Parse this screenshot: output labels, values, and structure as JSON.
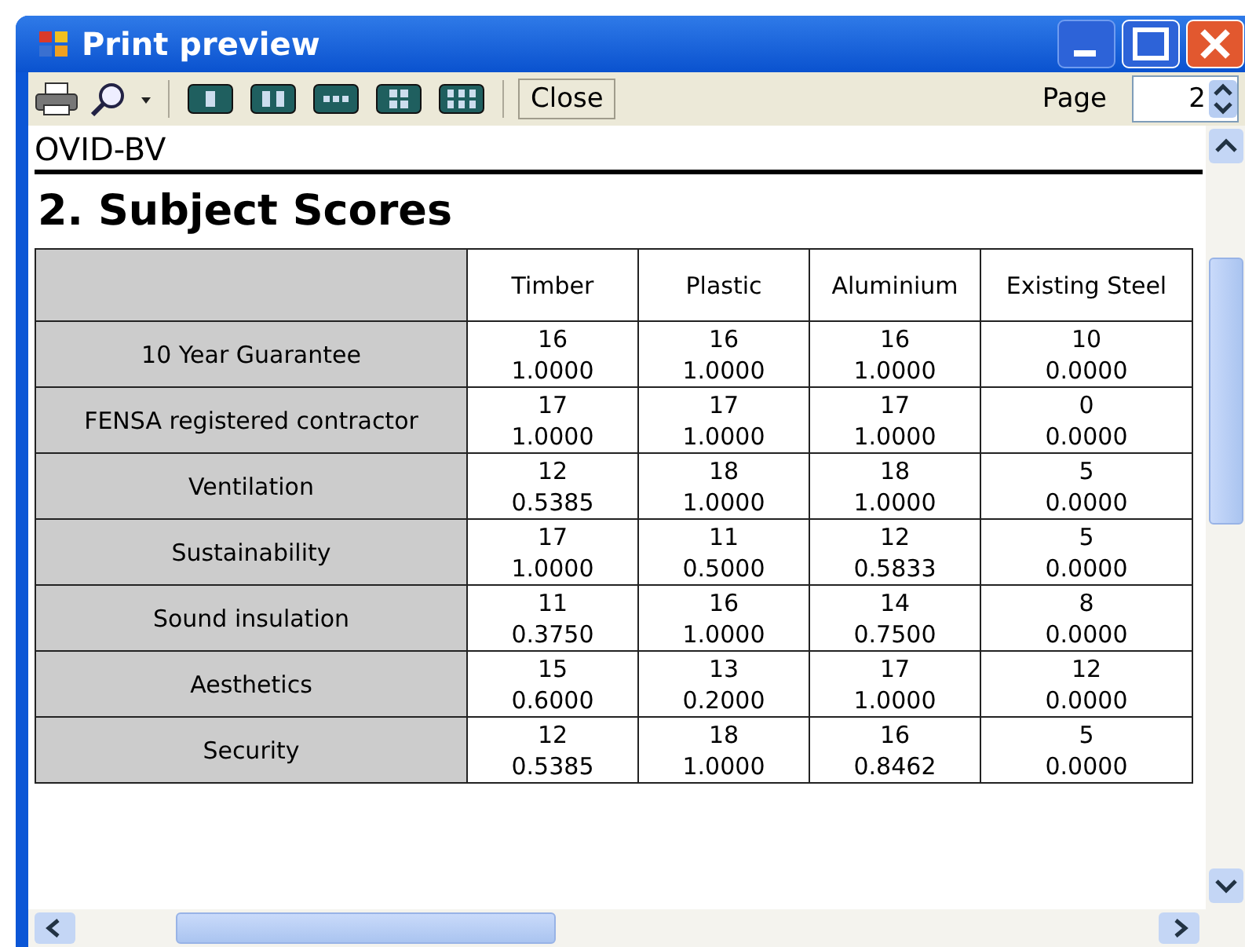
{
  "window": {
    "title": "Print preview"
  },
  "toolbar": {
    "close_button": "Close",
    "page_label": "Page",
    "page_value": "2"
  },
  "document": {
    "header": "OVID-BV",
    "heading": "2. Subject Scores",
    "table": {
      "columns": [
        "Timber",
        "Plastic",
        "Aluminium",
        "Existing Steel"
      ],
      "rows": [
        {
          "label": "10 Year Guarantee",
          "cells": [
            {
              "score": "16",
              "weight": "1.0000"
            },
            {
              "score": "16",
              "weight": "1.0000"
            },
            {
              "score": "16",
              "weight": "1.0000"
            },
            {
              "score": "10",
              "weight": "0.0000"
            }
          ]
        },
        {
          "label": "FENSA registered contractor",
          "cells": [
            {
              "score": "17",
              "weight": "1.0000"
            },
            {
              "score": "17",
              "weight": "1.0000"
            },
            {
              "score": "17",
              "weight": "1.0000"
            },
            {
              "score": "0",
              "weight": "0.0000"
            }
          ]
        },
        {
          "label": "Ventilation",
          "cells": [
            {
              "score": "12",
              "weight": "0.5385"
            },
            {
              "score": "18",
              "weight": "1.0000"
            },
            {
              "score": "18",
              "weight": "1.0000"
            },
            {
              "score": "5",
              "weight": "0.0000"
            }
          ]
        },
        {
          "label": "Sustainability",
          "cells": [
            {
              "score": "17",
              "weight": "1.0000"
            },
            {
              "score": "11",
              "weight": "0.5000"
            },
            {
              "score": "12",
              "weight": "0.5833"
            },
            {
              "score": "5",
              "weight": "0.0000"
            }
          ]
        },
        {
          "label": "Sound insulation",
          "cells": [
            {
              "score": "11",
              "weight": "0.3750"
            },
            {
              "score": "16",
              "weight": "1.0000"
            },
            {
              "score": "14",
              "weight": "0.7500"
            },
            {
              "score": "8",
              "weight": "0.0000"
            }
          ]
        },
        {
          "label": "Aesthetics",
          "cells": [
            {
              "score": "15",
              "weight": "0.6000"
            },
            {
              "score": "13",
              "weight": "0.2000"
            },
            {
              "score": "17",
              "weight": "1.0000"
            },
            {
              "score": "12",
              "weight": "0.0000"
            }
          ]
        },
        {
          "label": "Security",
          "cells": [
            {
              "score": "12",
              "weight": "0.5385"
            },
            {
              "score": "18",
              "weight": "1.0000"
            },
            {
              "score": "16",
              "weight": "0.8462"
            },
            {
              "score": "5",
              "weight": "0.0000"
            }
          ]
        }
      ]
    }
  }
}
